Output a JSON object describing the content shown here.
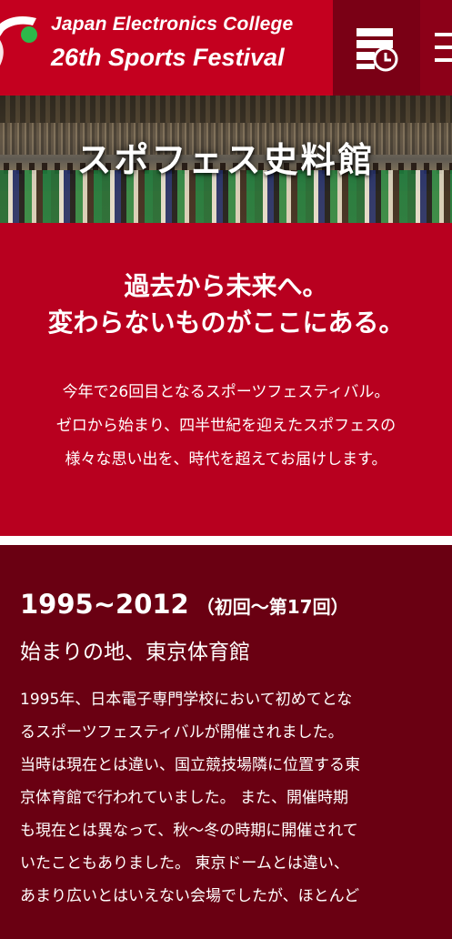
{
  "header": {
    "logo_line1": "Japan Electronics College",
    "logo_line2": "26th Sports Festival",
    "history_icon": "archive-history-icon",
    "menu_icon": "hamburger-menu-icon"
  },
  "hero": {
    "title": "スポフェス史料館"
  },
  "intro": {
    "heading_line1": "過去から未来へ。",
    "heading_line2": "変わらないものがここにある。",
    "text_line1": "今年で26回目となるスポーツフェスティバル。",
    "text_line2": "ゼロから始まり、四半世紀を迎えたスポフェスの",
    "text_line3": "様々な思い出を、時代を超えてお届けします。"
  },
  "history": {
    "years": "1995~2012",
    "range": "（初回～第17回）",
    "subtitle": "始まりの地、東京体育館",
    "body_lines": [
      "1995年、日本電子専門学校において初めてとな",
      "るスポーツフェスティバルが開催されました。",
      "当時は現在とは違い、国立競技場隣に位置する東",
      "京体育館で行われていました。 また、開催時期",
      "も現在とは異なって、秋～冬の時期に開催されて",
      "いたこともありました。 東京ドームとは違い、",
      "あまり広いとはいえない会場でしたが、ほとんど"
    ]
  },
  "colors": {
    "header_red": "#c4001f",
    "section_red": "#b8001f",
    "dark_red": "#6a0012",
    "logo_dot_green": "#2db84a"
  }
}
